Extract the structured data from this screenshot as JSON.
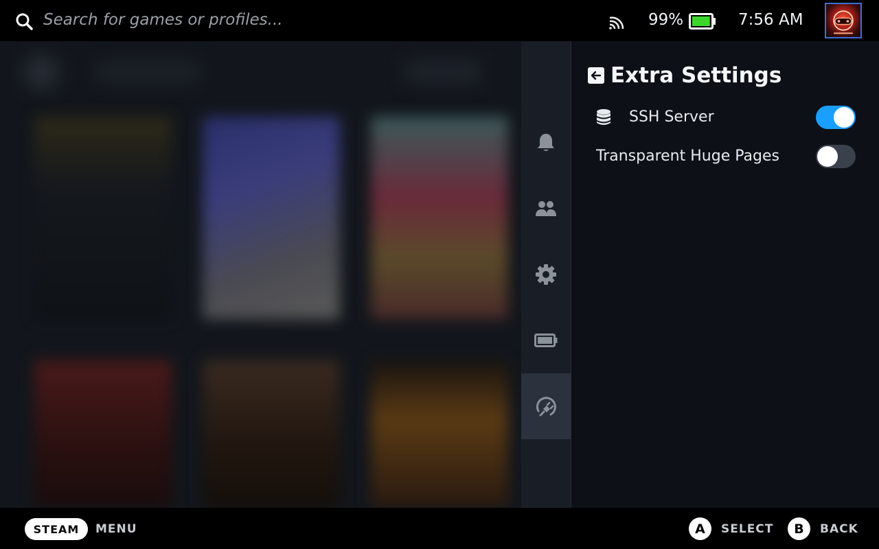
{
  "topbar": {
    "search_placeholder": "Search for games or profiles...",
    "battery_percent": "99%",
    "battery_level": 0.99,
    "time": "7:56 AM",
    "icons": [
      "search-icon",
      "cast-icon",
      "battery-icon",
      "avatar"
    ]
  },
  "sidenav": {
    "items": [
      {
        "name": "notifications",
        "icon": "bell-icon",
        "active": false
      },
      {
        "name": "friends",
        "icon": "friends-icon",
        "active": false
      },
      {
        "name": "settings",
        "icon": "gear-icon",
        "active": false
      },
      {
        "name": "performance",
        "icon": "battery-icon",
        "active": false
      },
      {
        "name": "plugins",
        "icon": "plug-icon",
        "active": true
      }
    ]
  },
  "panel": {
    "title": "Extra Settings",
    "settings": [
      {
        "label": "SSH Server",
        "icon": "database-icon",
        "enabled": true
      },
      {
        "label": "Transparent Huge Pages",
        "icon": "",
        "enabled": false
      }
    ]
  },
  "bottombar": {
    "steam_label": "STEAM",
    "menu_label": "MENU",
    "a_button": "A",
    "select_label": "SELECT",
    "b_button": "B",
    "back_label": "BACK"
  },
  "colors": {
    "accent": "#1a9fff",
    "panel_bg": "#0d1117",
    "nav_bg": "#191e26",
    "battery_fill": "#3ed62e"
  }
}
